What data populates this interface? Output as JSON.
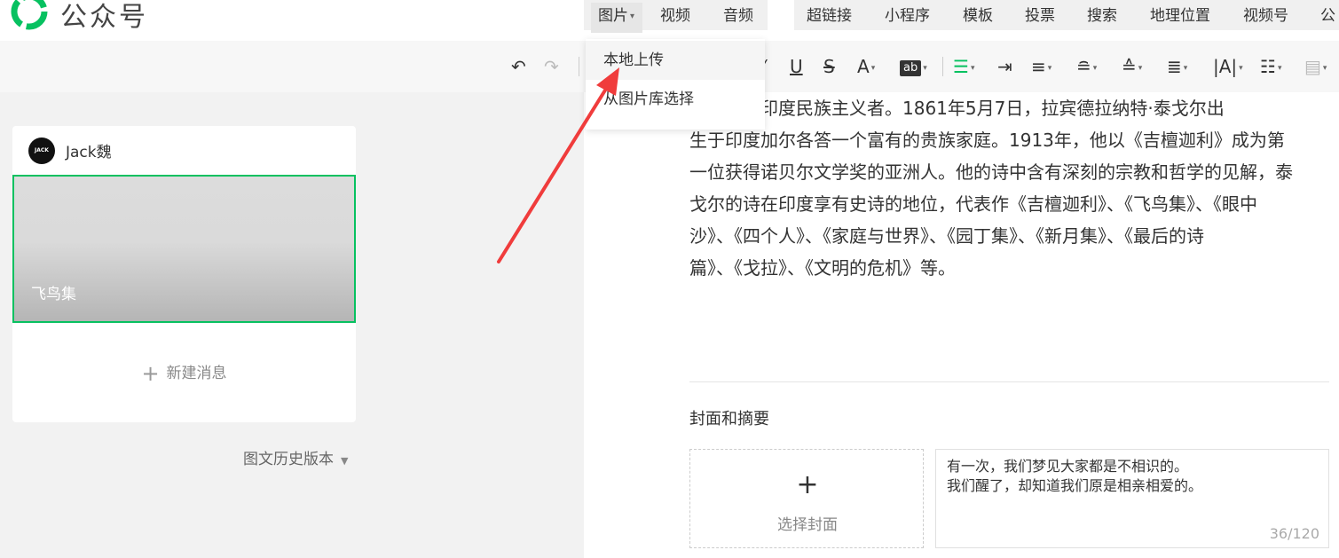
{
  "header": {
    "brand": "公众号"
  },
  "insert_menu": {
    "items": [
      "图片",
      "视频",
      "音频",
      "超链接",
      "小程序",
      "模板",
      "投票",
      "搜索",
      "地理位置",
      "视频号",
      "公"
    ]
  },
  "image_dropdown": {
    "items": [
      "本地上传",
      "从图片库选择"
    ]
  },
  "toolbar": {
    "undo_icon": "undo-icon",
    "redo_icon": "redo-icon",
    "underline": "U",
    "strikethrough": "S",
    "font_color": "A",
    "bg_color": "ab",
    "accent": "#07c160"
  },
  "sidebar": {
    "author": "Jack魏",
    "avatar_text": "JACK",
    "article_title": "飞鸟集",
    "new_message": "新建消息",
    "history": "图文历史版本"
  },
  "editor": {
    "paragraph_lines": [
      "哲学家和印度民族主义者。1861年5月7日，拉宾德拉纳特·泰戈尔出",
      "生于印度加尔各答一个富有的贵族家庭。1913年，他以《吉檀迦利》成为第",
      "一位获得诺贝尔文学奖的亚洲人。他的诗中含有深刻的宗教和哲学的见解，泰",
      "戈尔的诗在印度享有史诗的地位，代表作《吉檀迦利》、《飞鸟集》、《眼中",
      "沙》、《四个人》、《家庭与世界》、《园丁集》、《新月集》、《最后的诗",
      "篇》、《戈拉》、《文明的危机》等。"
    ],
    "cover_section_title": "封面和摘要",
    "cover_label": "选择封面",
    "summary_lines": [
      "有一次，我们梦见大家都是不相识的。",
      "我们醒了，却知道我们原是相亲相爱的。"
    ],
    "summary_count": "36/120"
  }
}
